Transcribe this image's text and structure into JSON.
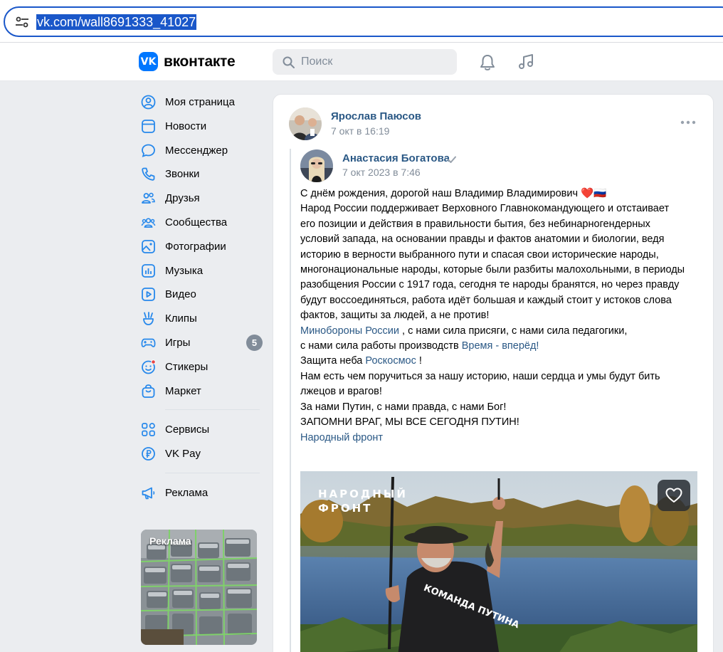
{
  "browser": {
    "url": "vk.com/wall8691333_41027"
  },
  "header": {
    "logo_text": "вконтакте",
    "search_placeholder": "Поиск"
  },
  "sidebar": {
    "items": [
      {
        "label": "Моя страница",
        "icon": "user-circle-icon"
      },
      {
        "label": "Новости",
        "icon": "news-icon"
      },
      {
        "label": "Мессенджер",
        "icon": "message-bubble-icon"
      },
      {
        "label": "Звонки",
        "icon": "phone-icon"
      },
      {
        "label": "Друзья",
        "icon": "friends-icon"
      },
      {
        "label": "Сообщества",
        "icon": "communities-icon"
      },
      {
        "label": "Фотографии",
        "icon": "photo-icon"
      },
      {
        "label": "Музыка",
        "icon": "music-bars-icon"
      },
      {
        "label": "Видео",
        "icon": "video-icon"
      },
      {
        "label": "Клипы",
        "icon": "clips-icon"
      },
      {
        "label": "Игры",
        "icon": "gamepad-icon",
        "badge": "5"
      },
      {
        "label": "Стикеры",
        "icon": "sticker-smile-icon"
      },
      {
        "label": "Маркет",
        "icon": "market-bag-icon"
      }
    ],
    "secondary": [
      {
        "label": "Сервисы",
        "icon": "services-grid-icon"
      },
      {
        "label": "VK Pay",
        "icon": "ruble-coin-icon"
      }
    ],
    "tertiary": [
      {
        "label": "Реклама",
        "icon": "megaphone-icon"
      }
    ],
    "ad_label": "Реклама"
  },
  "post": {
    "author": "Ярослав Паюсов",
    "date": "7 окт в 16:19",
    "repost": {
      "author": "Анастасия Богатова",
      "date": "7 окт 2023 в 7:46",
      "lines": [
        {
          "parts": [
            {
              "t": "С днём рождения, дорогой наш Владимир Владимирович ❤️🇷🇺"
            }
          ]
        },
        {
          "parts": [
            {
              "t": "Народ России поддерживает Верховного Главнокомандующего и отстаивает"
            }
          ]
        },
        {
          "parts": [
            {
              "t": "его позиции и действия в правильности бытия, без небинарногендерных"
            }
          ]
        },
        {
          "parts": [
            {
              "t": "условий запада, на основании правды и фактов анатомии и биологии, ведя"
            }
          ]
        },
        {
          "parts": [
            {
              "t": "историю в верности выбранного пути и спасая свои исторические народы,"
            }
          ]
        },
        {
          "parts": [
            {
              "t": "многонациональные народы, которые были разбиты малохольными, в периоды"
            }
          ]
        },
        {
          "parts": [
            {
              "t": "разобщения России с 1917 года, сегодня те народы бранятся, но через правду"
            }
          ]
        },
        {
          "parts": [
            {
              "t": "будут воссоединяться, работа идёт большая и каждый стоит у истоков слова"
            }
          ]
        },
        {
          "parts": [
            {
              "t": "фактов, защиты за людей, а не против!"
            }
          ]
        },
        {
          "parts": [
            {
              "t": "Минобороны России",
              "link": true
            },
            {
              "t": " , с нами сила присяги, с нами сила педагогики,"
            }
          ]
        },
        {
          "parts": [
            {
              "t": "с нами сила работы производств "
            },
            {
              "t": "Время - вперёд!",
              "link": true
            }
          ]
        },
        {
          "parts": [
            {
              "t": "Защита неба "
            },
            {
              "t": "Роскосмос",
              "link": true
            },
            {
              "t": " !"
            }
          ]
        },
        {
          "parts": [
            {
              "t": "Нам есть чем поручиться за нашу историю, наши сердца и умы будут бить"
            }
          ]
        },
        {
          "parts": [
            {
              "t": "лжецов и врагов!"
            }
          ]
        },
        {
          "parts": [
            {
              "t": " "
            }
          ]
        },
        {
          "parts": [
            {
              "t": "За нами Путин, с нами правда, с нами Бог!"
            }
          ]
        },
        {
          "parts": [
            {
              "t": "ЗАПОМНИ ВРАГ, МЫ ВСЕ СЕГОДНЯ ПУТИН!"
            }
          ]
        },
        {
          "parts": [
            {
              "t": "Народный фронт",
              "link": true
            }
          ]
        }
      ],
      "media_caption_line1": "НАРОДНЫЙ",
      "media_caption_line2": "ФРОНТ",
      "shirt_text": "КОМАНДА ПУТИНА"
    }
  },
  "colors": {
    "accent": "#0077ff",
    "link": "#2a5885",
    "muted": "#818c99",
    "bg": "#ebedf0"
  }
}
